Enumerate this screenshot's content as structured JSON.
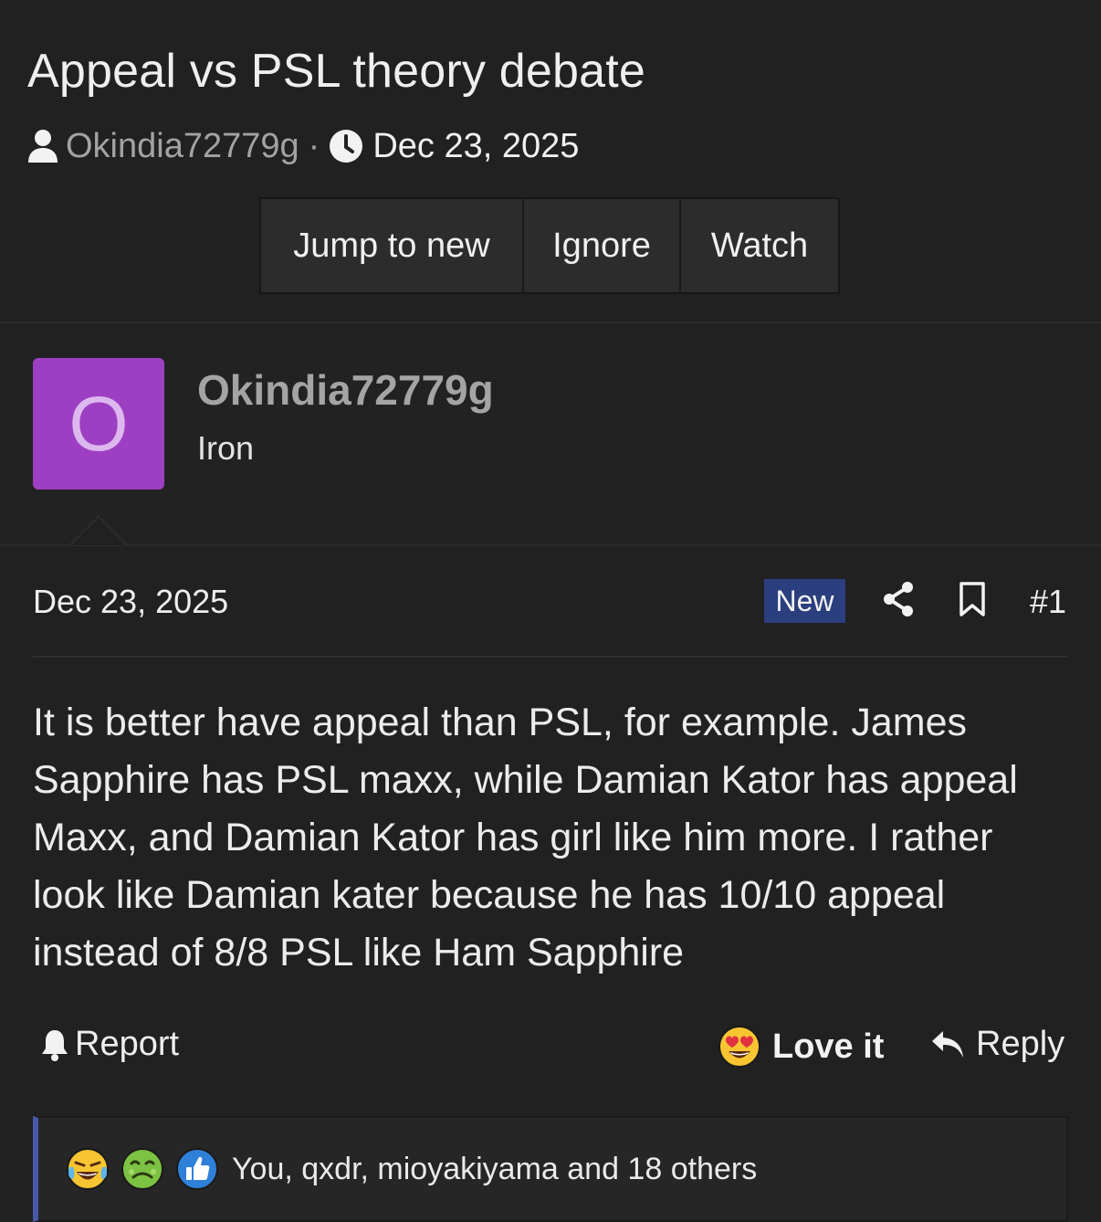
{
  "thread": {
    "title": "Appeal vs PSL theory debate",
    "author": "Okindia72779g",
    "separator": "·",
    "date": "Dec 23, 2025",
    "buttons": {
      "jump": "Jump to new",
      "ignore": "Ignore",
      "watch": "Watch"
    }
  },
  "user": {
    "avatar_letter": "O",
    "avatar_color": "#9d3fc2",
    "name": "Okindia72779g",
    "title": "Iron"
  },
  "post": {
    "date": "Dec 23, 2025",
    "badge": "New",
    "number": "#1",
    "body": "It is better have appeal than PSL, for example. James Sapphire has PSL maxx, while Damian Kator has appeal Maxx, and Damian Kator has girl like him more. I rather look like Damian kater because he has 10/10 appeal instead of 8/8 PSL like Ham Sapphire"
  },
  "actions": {
    "report": "Report",
    "love": "Love it",
    "reply": "Reply"
  },
  "reactions": {
    "summary": "You, qxdr, mioyakiyama and 18 others",
    "icons": [
      "crying-laughing-icon",
      "nauseated-icon",
      "thumbs-up-icon"
    ]
  },
  "colors": {
    "background": "#212122",
    "accent_badge": "#2b3e7e",
    "reactions_border": "#4a58a8"
  }
}
